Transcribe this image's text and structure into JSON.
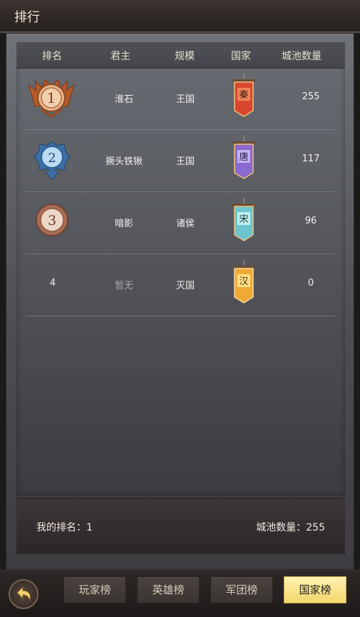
{
  "title": "排行",
  "columns": [
    "排名",
    "君主",
    "规模",
    "国家",
    "城池数量"
  ],
  "rows": [
    {
      "rank": "1",
      "lord": "淮石",
      "scale": "王国",
      "country": "秦",
      "cities": "255",
      "medal": "gold-medal-icon"
    },
    {
      "rank": "2",
      "lord": "撅头铁锹",
      "scale": "王国",
      "country": "唐",
      "cities": "117",
      "medal": "silver-medal-icon"
    },
    {
      "rank": "3",
      "lord": "暗影",
      "scale": "诸侯",
      "country": "宋",
      "cities": "96",
      "medal": "bronze-medal-icon"
    },
    {
      "rank": "4",
      "lord": "暂无",
      "scale": "灭国",
      "country": "汉",
      "cities": "0",
      "medal": ""
    }
  ],
  "footer": {
    "my_rank": "我的排名：1",
    "city_count": "城池数量：255"
  },
  "tabs": [
    {
      "label": "玩家榜",
      "active": false
    },
    {
      "label": "英雄榜",
      "active": false
    },
    {
      "label": "军团榜",
      "active": false
    },
    {
      "label": "国家榜",
      "active": true
    }
  ],
  "colors": {
    "flag_qin": "#d8462f",
    "flag_tang": "#8a6ad0",
    "flag_song": "#6bc6d0",
    "flag_han": "#f0a935",
    "active_tab": "#f6dd7a"
  },
  "icons": {
    "back": "back-arrow-icon"
  }
}
